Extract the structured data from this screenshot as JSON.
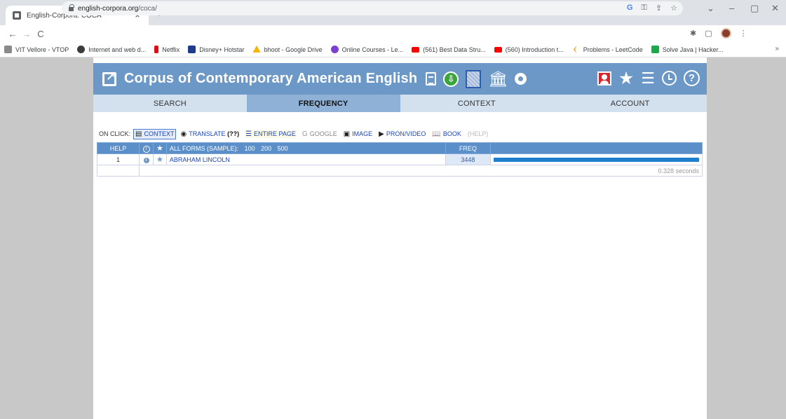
{
  "browser": {
    "tab_title": "English-Corpora: COCA",
    "tab_close": "×",
    "new_tab": "+",
    "url_host": "english-corpora.org",
    "url_path": "/coca/",
    "window": {
      "minimize": "–",
      "restore": "▢",
      "close": "✕",
      "chevron": "⌄"
    }
  },
  "bookmarks": [
    {
      "label": "VIT Vellore - VTOP",
      "color": "#8a8a8a"
    },
    {
      "label": "Internet and web d...",
      "color": "#3b3b3b"
    },
    {
      "label": "Netflix",
      "color": "#e50914"
    },
    {
      "label": "Disney+ Hotstar",
      "color": "#1f3c88"
    },
    {
      "label": "bhoot - Google Drive",
      "color": "#f4b400"
    },
    {
      "label": "Online Courses - Le...",
      "color": "#7b3fd1"
    },
    {
      "label": "(561) Best Data Stru...",
      "color": "#ff0000"
    },
    {
      "label": "(560) Introduction t...",
      "color": "#ff0000"
    },
    {
      "label": "Problems - LeetCode",
      "color": "#f89f1b"
    },
    {
      "label": "Solve Java | Hacker...",
      "color": "#1ba94c"
    }
  ],
  "bookmarks_more": "»",
  "site": {
    "title": "Corpus of Contemporary American English"
  },
  "nav": {
    "tabs": [
      {
        "label": "SEARCH"
      },
      {
        "label": "FREQUENCY"
      },
      {
        "label": "CONTEXT"
      },
      {
        "label": "ACCOUNT"
      }
    ]
  },
  "onclick": {
    "label": "ON CLICK:",
    "context": "CONTEXT",
    "translate": "TRANSLATE",
    "translate_q": "(??)",
    "entire_page": "ENTIRE PAGE",
    "google": "GOOGLE",
    "image": "IMAGE",
    "pron_video": "PRON/VIDEO",
    "book": "BOOK",
    "help": "(HELP)"
  },
  "results": {
    "header": {
      "help": "HELP",
      "all_forms": "ALL FORMS (SAMPLE):",
      "sample_100": "100",
      "sample_200": "200",
      "sample_500": "500",
      "freq": "FREQ"
    },
    "rows": [
      {
        "num": "1",
        "word": "ABRAHAM LINCOLN",
        "freq": "3448",
        "bar_fraction": 1.0
      }
    ],
    "time": "0.328 seconds"
  }
}
